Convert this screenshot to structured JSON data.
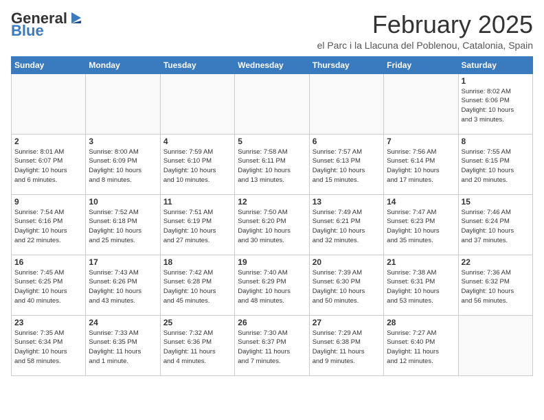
{
  "header": {
    "logo_general": "General",
    "logo_blue": "Blue",
    "month_year": "February 2025",
    "location": "el Parc i la Llacuna del Poblenou, Catalonia, Spain"
  },
  "days_of_week": [
    "Sunday",
    "Monday",
    "Tuesday",
    "Wednesday",
    "Thursday",
    "Friday",
    "Saturday"
  ],
  "weeks": [
    [
      {
        "day": "",
        "info": ""
      },
      {
        "day": "",
        "info": ""
      },
      {
        "day": "",
        "info": ""
      },
      {
        "day": "",
        "info": ""
      },
      {
        "day": "",
        "info": ""
      },
      {
        "day": "",
        "info": ""
      },
      {
        "day": "1",
        "info": "Sunrise: 8:02 AM\nSunset: 6:06 PM\nDaylight: 10 hours\nand 3 minutes."
      }
    ],
    [
      {
        "day": "2",
        "info": "Sunrise: 8:01 AM\nSunset: 6:07 PM\nDaylight: 10 hours\nand 6 minutes."
      },
      {
        "day": "3",
        "info": "Sunrise: 8:00 AM\nSunset: 6:09 PM\nDaylight: 10 hours\nand 8 minutes."
      },
      {
        "day": "4",
        "info": "Sunrise: 7:59 AM\nSunset: 6:10 PM\nDaylight: 10 hours\nand 10 minutes."
      },
      {
        "day": "5",
        "info": "Sunrise: 7:58 AM\nSunset: 6:11 PM\nDaylight: 10 hours\nand 13 minutes."
      },
      {
        "day": "6",
        "info": "Sunrise: 7:57 AM\nSunset: 6:13 PM\nDaylight: 10 hours\nand 15 minutes."
      },
      {
        "day": "7",
        "info": "Sunrise: 7:56 AM\nSunset: 6:14 PM\nDaylight: 10 hours\nand 17 minutes."
      },
      {
        "day": "8",
        "info": "Sunrise: 7:55 AM\nSunset: 6:15 PM\nDaylight: 10 hours\nand 20 minutes."
      }
    ],
    [
      {
        "day": "9",
        "info": "Sunrise: 7:54 AM\nSunset: 6:16 PM\nDaylight: 10 hours\nand 22 minutes."
      },
      {
        "day": "10",
        "info": "Sunrise: 7:52 AM\nSunset: 6:18 PM\nDaylight: 10 hours\nand 25 minutes."
      },
      {
        "day": "11",
        "info": "Sunrise: 7:51 AM\nSunset: 6:19 PM\nDaylight: 10 hours\nand 27 minutes."
      },
      {
        "day": "12",
        "info": "Sunrise: 7:50 AM\nSunset: 6:20 PM\nDaylight: 10 hours\nand 30 minutes."
      },
      {
        "day": "13",
        "info": "Sunrise: 7:49 AM\nSunset: 6:21 PM\nDaylight: 10 hours\nand 32 minutes."
      },
      {
        "day": "14",
        "info": "Sunrise: 7:47 AM\nSunset: 6:23 PM\nDaylight: 10 hours\nand 35 minutes."
      },
      {
        "day": "15",
        "info": "Sunrise: 7:46 AM\nSunset: 6:24 PM\nDaylight: 10 hours\nand 37 minutes."
      }
    ],
    [
      {
        "day": "16",
        "info": "Sunrise: 7:45 AM\nSunset: 6:25 PM\nDaylight: 10 hours\nand 40 minutes."
      },
      {
        "day": "17",
        "info": "Sunrise: 7:43 AM\nSunset: 6:26 PM\nDaylight: 10 hours\nand 43 minutes."
      },
      {
        "day": "18",
        "info": "Sunrise: 7:42 AM\nSunset: 6:28 PM\nDaylight: 10 hours\nand 45 minutes."
      },
      {
        "day": "19",
        "info": "Sunrise: 7:40 AM\nSunset: 6:29 PM\nDaylight: 10 hours\nand 48 minutes."
      },
      {
        "day": "20",
        "info": "Sunrise: 7:39 AM\nSunset: 6:30 PM\nDaylight: 10 hours\nand 50 minutes."
      },
      {
        "day": "21",
        "info": "Sunrise: 7:38 AM\nSunset: 6:31 PM\nDaylight: 10 hours\nand 53 minutes."
      },
      {
        "day": "22",
        "info": "Sunrise: 7:36 AM\nSunset: 6:32 PM\nDaylight: 10 hours\nand 56 minutes."
      }
    ],
    [
      {
        "day": "23",
        "info": "Sunrise: 7:35 AM\nSunset: 6:34 PM\nDaylight: 10 hours\nand 58 minutes."
      },
      {
        "day": "24",
        "info": "Sunrise: 7:33 AM\nSunset: 6:35 PM\nDaylight: 11 hours\nand 1 minute."
      },
      {
        "day": "25",
        "info": "Sunrise: 7:32 AM\nSunset: 6:36 PM\nDaylight: 11 hours\nand 4 minutes."
      },
      {
        "day": "26",
        "info": "Sunrise: 7:30 AM\nSunset: 6:37 PM\nDaylight: 11 hours\nand 7 minutes."
      },
      {
        "day": "27",
        "info": "Sunrise: 7:29 AM\nSunset: 6:38 PM\nDaylight: 11 hours\nand 9 minutes."
      },
      {
        "day": "28",
        "info": "Sunrise: 7:27 AM\nSunset: 6:40 PM\nDaylight: 11 hours\nand 12 minutes."
      },
      {
        "day": "",
        "info": ""
      }
    ]
  ]
}
